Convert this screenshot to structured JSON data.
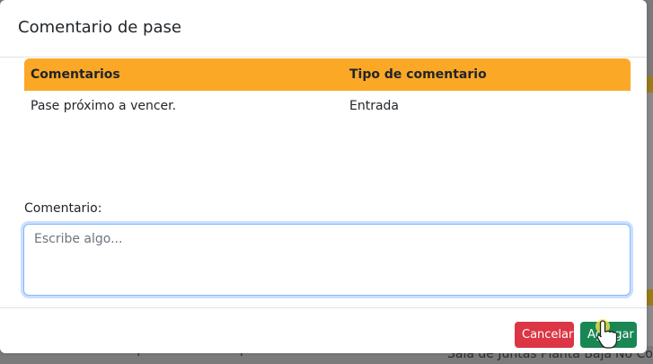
{
  "modal": {
    "title": "Comentario de pase"
  },
  "table": {
    "columns": [
      "Comentarios",
      "Tipo de comentario"
    ],
    "rows": [
      [
        "Pase próximo a vencer.",
        "Entrada"
      ]
    ]
  },
  "form": {
    "label": "Comentario:",
    "placeholder": "Escribe algo...",
    "value": ""
  },
  "footer": {
    "cancel_label": "Cancelar",
    "add_label": "Agregar"
  },
  "background": {
    "bottom_texts": [
      "Permiso de operación de maquinaria",
      "Sala de Juntas Planta Baja",
      "No Co"
    ]
  },
  "colors": {
    "table_header": "#fba826",
    "cancel": "#dc3545",
    "add": "#198754",
    "focus_border": "#86b7fe"
  }
}
